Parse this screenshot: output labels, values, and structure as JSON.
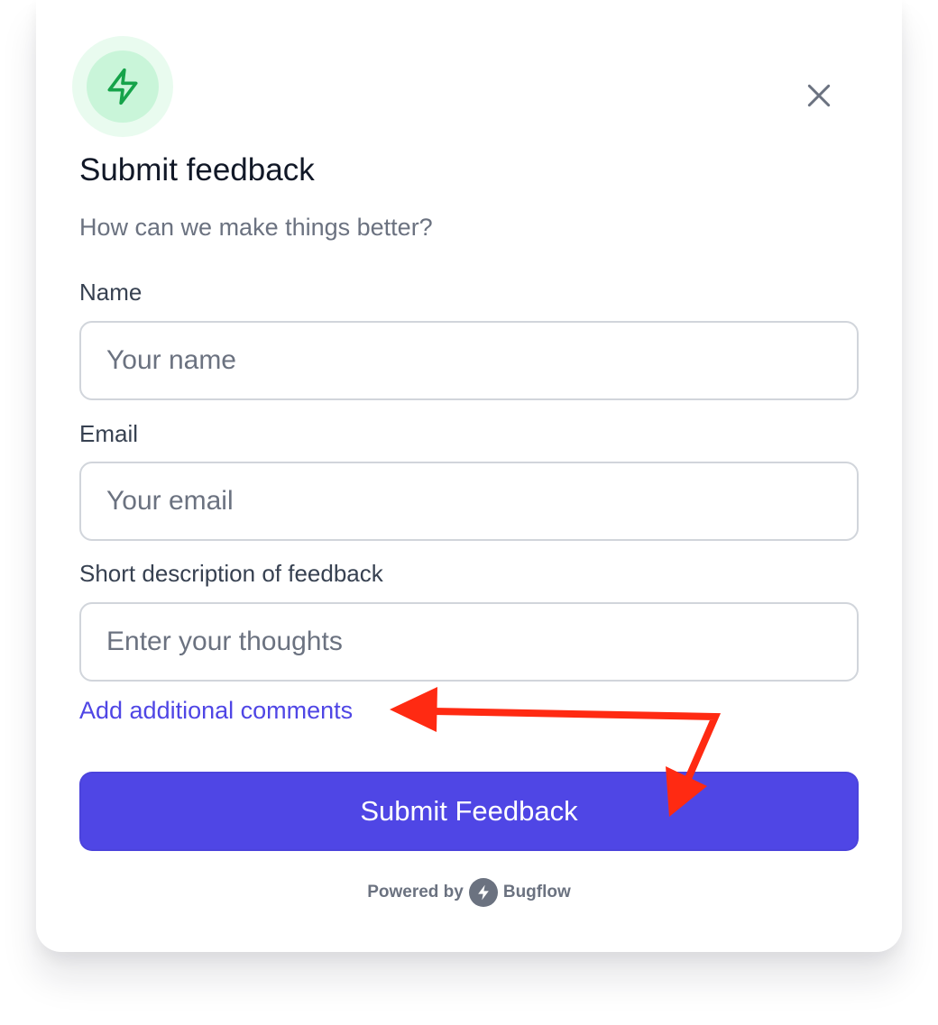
{
  "icons": {
    "header": "lightning-bolt-icon",
    "close": "close-icon",
    "brand": "lightning-bolt-icon"
  },
  "colors": {
    "accent": "#4f46e5",
    "icon_green": "#16a34a",
    "icon_bg_outer": "#e9fbef",
    "icon_bg_inner": "#c9f5d9",
    "annotation_red": "#ff2a12"
  },
  "header": {
    "title": "Submit feedback",
    "subtitle": "How can we make things better?"
  },
  "form": {
    "name": {
      "label": "Name",
      "placeholder": "Your name",
      "value": ""
    },
    "email": {
      "label": "Email",
      "placeholder": "Your email",
      "value": ""
    },
    "description": {
      "label": "Short description of feedback",
      "placeholder": "Enter your thoughts",
      "value": ""
    },
    "add_comments_link": "Add additional comments",
    "submit_label": "Submit Feedback"
  },
  "footer": {
    "powered_by": "Powered by",
    "brand": "Bugflow"
  }
}
